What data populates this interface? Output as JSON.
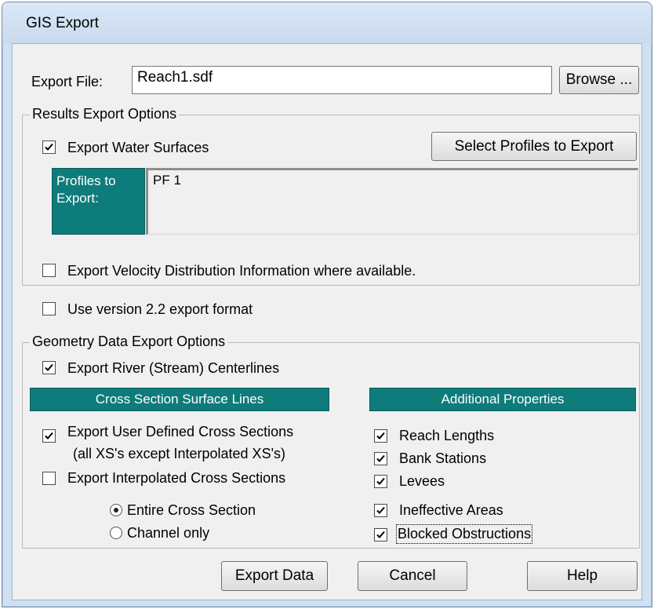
{
  "window": {
    "title": "GIS Export"
  },
  "export_file": {
    "label": "Export File:",
    "value": "Reach1.sdf",
    "browse": "Browse ..."
  },
  "results": {
    "legend": "Results Export Options",
    "water_surfaces": {
      "label": "Export Water Surfaces",
      "checked": true
    },
    "select_profiles": "Select Profiles to Export",
    "profiles_label_line1": "Profiles to",
    "profiles_label_line2": "Export:",
    "profiles": [
      "PF 1"
    ],
    "velocity": {
      "label": "Export Velocity Distribution Information where available.",
      "checked": false
    }
  },
  "version22": {
    "label": "Use version 2.2 export format",
    "checked": false
  },
  "geometry": {
    "legend": "Geometry Data Export Options",
    "centerlines": {
      "label": "Export River (Stream) Centerlines",
      "checked": true
    },
    "xs_header": "Cross Section Surface Lines",
    "user_xs": {
      "label": "Export User Defined Cross Sections",
      "note": "(all XS's except Interpolated XS's)",
      "checked": true
    },
    "interp_xs": {
      "label": "Export Interpolated Cross Sections",
      "checked": false
    },
    "radio_entire": {
      "label": "Entire Cross Section",
      "selected": true
    },
    "radio_channel": {
      "label": "Channel only",
      "selected": false
    },
    "props_header": "Additional Properties",
    "props": [
      {
        "label": "Reach Lengths",
        "checked": true
      },
      {
        "label": "Bank Stations",
        "checked": true
      },
      {
        "label": "Levees",
        "checked": true
      },
      {
        "label": "Ineffective Areas",
        "checked": true
      },
      {
        "label": "Blocked Obstructions",
        "checked": true
      }
    ]
  },
  "buttons": {
    "export": "Export Data",
    "cancel": "Cancel",
    "help": "Help"
  },
  "colors": {
    "accent_teal": "#0e7c7b",
    "dialog_bg": "#f0f0f0",
    "frame": "#cfe0f2"
  }
}
